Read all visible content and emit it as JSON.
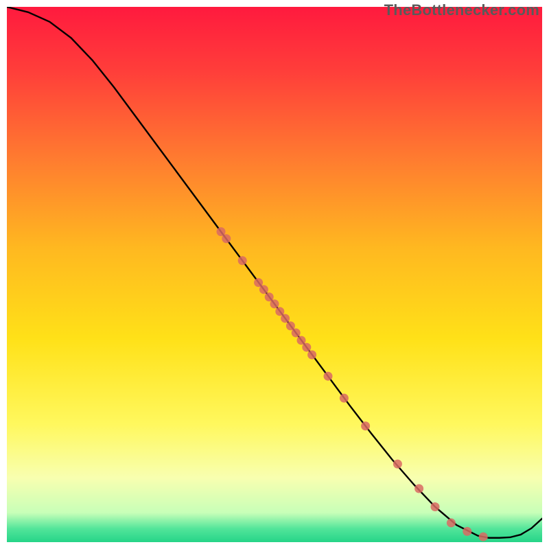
{
  "watermark": "TheBottlenecker.com",
  "chart_data": {
    "type": "line",
    "title": "",
    "xlabel": "",
    "ylabel": "",
    "xlim": [
      0,
      100
    ],
    "ylim": [
      0,
      100
    ],
    "background_gradient": {
      "stops": [
        {
          "offset": 0.0,
          "color": "#ff1a3e"
        },
        {
          "offset": 0.12,
          "color": "#ff3e3a"
        },
        {
          "offset": 0.28,
          "color": "#ff7a30"
        },
        {
          "offset": 0.45,
          "color": "#ffb820"
        },
        {
          "offset": 0.62,
          "color": "#ffe118"
        },
        {
          "offset": 0.78,
          "color": "#fff85e"
        },
        {
          "offset": 0.88,
          "color": "#f8ffb0"
        },
        {
          "offset": 0.945,
          "color": "#c8ffb8"
        },
        {
          "offset": 0.975,
          "color": "#52e59a"
        },
        {
          "offset": 1.0,
          "color": "#25d488"
        }
      ]
    },
    "series": [
      {
        "name": "curve",
        "type": "line",
        "color": "#000000",
        "x": [
          0,
          4,
          8,
          12,
          16,
          20,
          24,
          28,
          32,
          36,
          40,
          44,
          48,
          52,
          56,
          60,
          64,
          68,
          72,
          76,
          80,
          84,
          88,
          90,
          92,
          94,
          96,
          98,
          100
        ],
        "y": [
          100,
          99,
          97.2,
          94.2,
          90,
          85,
          79.6,
          74.2,
          68.8,
          63.4,
          58,
          52.6,
          47.2,
          41.8,
          36.4,
          31,
          25.6,
          20.4,
          15.4,
          10.8,
          6.6,
          3.2,
          1.2,
          0.8,
          0.8,
          0.9,
          1.4,
          2.6,
          4.4
        ]
      },
      {
        "name": "markers",
        "type": "scatter",
        "color": "#d96a63",
        "x": [
          40,
          41,
          44,
          47,
          48,
          49,
          50,
          51,
          52,
          53,
          54,
          55,
          56,
          57,
          60,
          63,
          67,
          73,
          77,
          80,
          83,
          86,
          89
        ],
        "y": [
          58,
          56.7,
          52.6,
          48.5,
          47.2,
          45.8,
          44.5,
          43.1,
          41.8,
          40.4,
          39.1,
          37.7,
          36.4,
          35.0,
          31.0,
          26.9,
          21.7,
          14.6,
          10.0,
          6.6,
          3.6,
          2.0,
          1.0
        ]
      }
    ]
  }
}
